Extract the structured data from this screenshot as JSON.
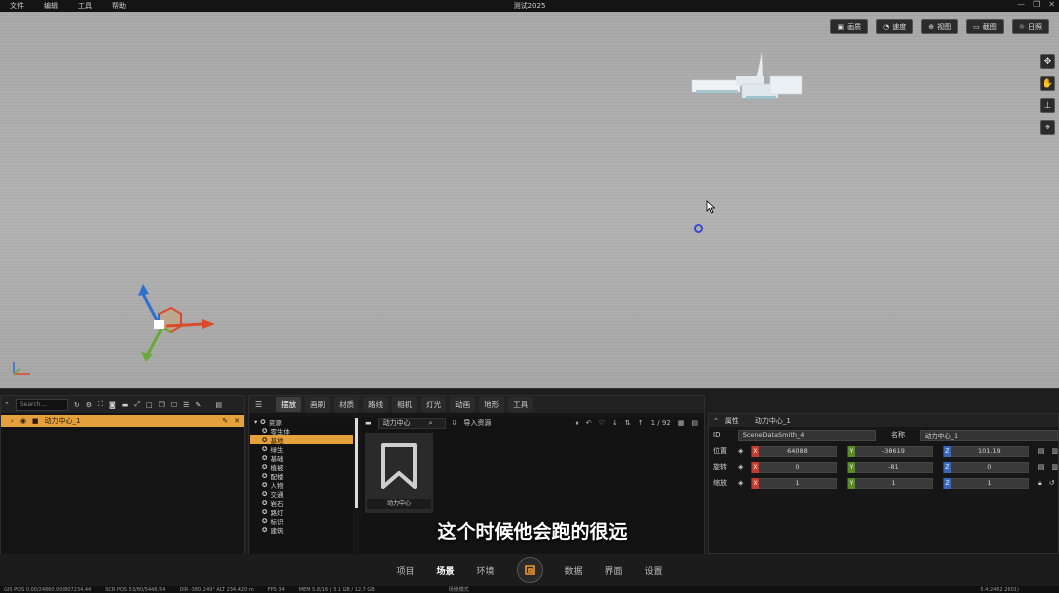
{
  "menubar": {
    "items": [
      "文件",
      "编辑",
      "工具",
      "帮助"
    ],
    "title": "测试2025"
  },
  "viewport_toolbar": [
    {
      "label": "画质",
      "icon": "image-icon"
    },
    {
      "label": "速度",
      "icon": "speed-icon"
    },
    {
      "label": "视图",
      "icon": "view-icon"
    },
    {
      "label": "截图",
      "icon": "screenshot-icon"
    },
    {
      "label": "日照",
      "icon": "sun-icon"
    }
  ],
  "outliner": {
    "search_placeholder": "Search...",
    "selected_item": "动力中心_1"
  },
  "assets": {
    "tabs": [
      "摆放",
      "画刷",
      "材质",
      "路线",
      "相机",
      "灯光",
      "动画",
      "地形",
      "工具"
    ],
    "active_tab": "摆放",
    "tree": [
      {
        "label": "资源",
        "root": true
      },
      {
        "label": "零生体"
      },
      {
        "label": "基地",
        "selected": true
      },
      {
        "label": "绿生"
      },
      {
        "label": "基础"
      },
      {
        "label": "植被"
      },
      {
        "label": "配楼"
      },
      {
        "label": "人物"
      },
      {
        "label": "交通"
      },
      {
        "label": "岩石"
      },
      {
        "label": "路灯"
      },
      {
        "label": "标识"
      },
      {
        "label": "建筑"
      }
    ],
    "path": "动力中心",
    "import_label": "导入资源",
    "page": "1 / 92",
    "card_label": "动力中心"
  },
  "subtitle": "这个时候他会跑的很远",
  "properties": {
    "header": "属性",
    "name_value": "动力中心_1",
    "id_label": "ID",
    "id_value": "SceneDataSmith_4",
    "name_label": "名称",
    "name_field": "动力中心_1",
    "position": {
      "label": "位置",
      "x": "64088",
      "y": "-38619",
      "z": "101.19"
    },
    "rotation": {
      "label": "旋转",
      "x": "0",
      "y": "-81",
      "z": "0",
      "x_fill": 0.45,
      "y_fill": 0.5,
      "z_fill": 0.45
    },
    "scale": {
      "label": "缩放",
      "x": "1",
      "y": "1",
      "z": "1"
    }
  },
  "bottom_nav": [
    "项目",
    "场景",
    "环境",
    "数据",
    "界面",
    "设置"
  ],
  "bottom_nav_active": "场景",
  "status": {
    "gis": "GIS POS  0.00/24860.00/807234.44",
    "scr": "SCR POS  53/80/5446.54",
    "dir": "DIR  -380.249°   ALT  234.420 m",
    "fps": "FPS  34",
    "mem": "MEM  5.8/16  |  3.1 GB / 12.7 GB",
    "mode": "场景模式",
    "coord": "5.4:2462 2601)"
  }
}
